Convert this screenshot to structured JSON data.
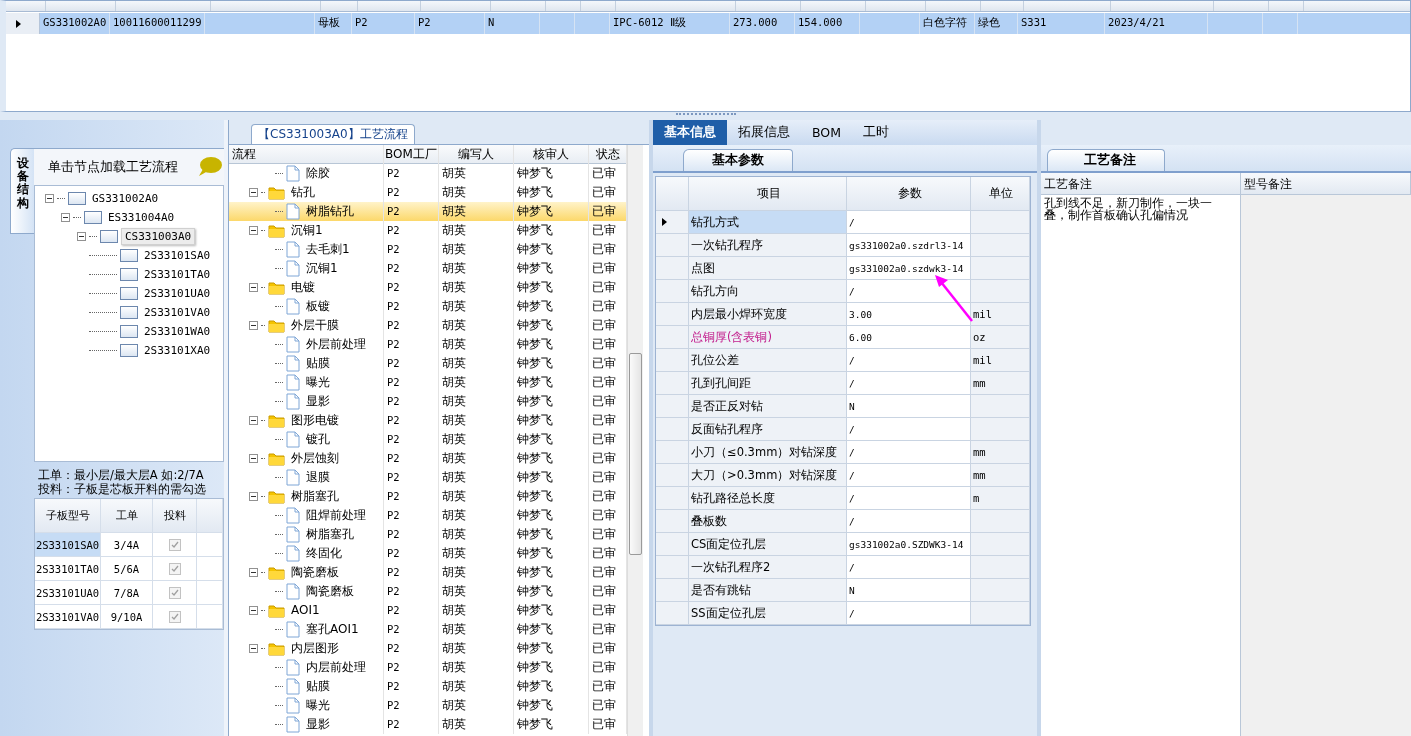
{
  "top_grid": {
    "row": {
      "selected": true,
      "cells": {
        "column_1": "GS331002A0",
        "column_2": "10011600011299",
        "column_4": "母板",
        "column_5": "P2",
        "column_6": "P2",
        "column_7": "N",
        "column_10": "IPC-6012 Ⅱ级",
        "column_11": "273.000",
        "column_12": "154.000",
        "column_14": "白色字符",
        "column_15": "绿色",
        "column_16": "S331",
        "column_17": "2023/4/21"
      }
    }
  },
  "structure_panel": {
    "tab": "设备结构",
    "hint": "单击节点加载工艺流程",
    "tree": [
      {
        "label": "GS331002A0",
        "selected": false,
        "expanded": true,
        "children": [
          {
            "label": "ES331004A0",
            "selected": false,
            "expanded": true,
            "children": [
              {
                "label": "CS331003A0",
                "selected": true,
                "expanded": true,
                "children": [
                  {
                    "label": "2S33101SA0",
                    "selected": false
                  },
                  {
                    "label": "2S33101TA0",
                    "selected": false
                  },
                  {
                    "label": "2S33101UA0",
                    "selected": false
                  },
                  {
                    "label": "2S33101VA0",
                    "selected": false
                  },
                  {
                    "label": "2S33101WA0",
                    "selected": false
                  },
                  {
                    "label": "2S33101XA0",
                    "selected": false
                  }
                ]
              }
            ]
          }
        ]
      }
    ],
    "notes": [
      "工单：最小层/最大层A 如:2/7A",
      "投料：子板是芯板开料的需勾选"
    ],
    "subboard_table": {
      "columns": [
        "子板型号",
        "工单",
        "投料"
      ],
      "rows": [
        {
          "model": "2S33101SA0",
          "work_order": "3/4A",
          "feed": true,
          "selected": true
        },
        {
          "model": "2S33101TA0",
          "work_order": "5/6A",
          "feed": true,
          "selected": false
        },
        {
          "model": "2S33101UA0",
          "work_order": "7/8A",
          "feed": true,
          "selected": false
        },
        {
          "model": "2S33101VA0",
          "work_order": "9/10A",
          "feed": true,
          "selected": false
        }
      ]
    }
  },
  "process_panel": {
    "title": "【CS331003A0】工艺流程",
    "columns": [
      "流程",
      "BOM工厂",
      "编写人",
      "核审人",
      "状态"
    ],
    "nodes": [
      {
        "label": "除胶",
        "factory": "P2",
        "writer": "胡英",
        "reviewer": "钟梦飞",
        "status": "已审",
        "selected": false
      },
      {
        "label": "钻孔",
        "factory": "P2",
        "writer": "胡英",
        "reviewer": "钟梦飞",
        "status": "已审",
        "selected": false,
        "expanded": true,
        "children": [
          {
            "label": "树脂钻孔",
            "factory": "P2",
            "writer": "胡英",
            "reviewer": "钟梦飞",
            "status": "已审",
            "selected": true
          }
        ]
      },
      {
        "label": "沉铜1",
        "factory": "P2",
        "writer": "胡英",
        "reviewer": "钟梦飞",
        "status": "已审",
        "selected": false,
        "expanded": true,
        "children": [
          {
            "label": "去毛刺1",
            "factory": "P2",
            "writer": "胡英",
            "reviewer": "钟梦飞",
            "status": "已审",
            "selected": false
          },
          {
            "label": "沉铜1",
            "factory": "P2",
            "writer": "胡英",
            "reviewer": "钟梦飞",
            "status": "已审",
            "selected": false
          }
        ]
      },
      {
        "label": "电镀",
        "factory": "P2",
        "writer": "胡英",
        "reviewer": "钟梦飞",
        "status": "已审",
        "selected": false,
        "expanded": true,
        "children": [
          {
            "label": "板镀",
            "factory": "P2",
            "writer": "胡英",
            "reviewer": "钟梦飞",
            "status": "已审",
            "selected": false
          }
        ]
      },
      {
        "label": "外层干膜",
        "factory": "P2",
        "writer": "胡英",
        "reviewer": "钟梦飞",
        "status": "已审",
        "selected": false,
        "expanded": true,
        "children": [
          {
            "label": "外层前处理",
            "factory": "P2",
            "writer": "胡英",
            "reviewer": "钟梦飞",
            "status": "已审",
            "selected": false
          },
          {
            "label": "贴膜",
            "factory": "P2",
            "writer": "胡英",
            "reviewer": "钟梦飞",
            "status": "已审",
            "selected": false
          },
          {
            "label": "曝光",
            "factory": "P2",
            "writer": "胡英",
            "reviewer": "钟梦飞",
            "status": "已审",
            "selected": false
          },
          {
            "label": "显影",
            "factory": "P2",
            "writer": "胡英",
            "reviewer": "钟梦飞",
            "status": "已审",
            "selected": false
          }
        ]
      },
      {
        "label": "图形电镀",
        "factory": "P2",
        "writer": "胡英",
        "reviewer": "钟梦飞",
        "status": "已审",
        "selected": false,
        "expanded": true,
        "children": [
          {
            "label": "镀孔",
            "factory": "P2",
            "writer": "胡英",
            "reviewer": "钟梦飞",
            "status": "已审",
            "selected": false
          }
        ]
      },
      {
        "label": "外层蚀刻",
        "factory": "P2",
        "writer": "胡英",
        "reviewer": "钟梦飞",
        "status": "已审",
        "selected": false,
        "expanded": true,
        "children": [
          {
            "label": "退膜",
            "factory": "P2",
            "writer": "胡英",
            "reviewer": "钟梦飞",
            "status": "已审",
            "selected": false
          }
        ]
      },
      {
        "label": "树脂塞孔",
        "factory": "P2",
        "writer": "胡英",
        "reviewer": "钟梦飞",
        "status": "已审",
        "selected": false,
        "expanded": true,
        "children": [
          {
            "label": "阻焊前处理",
            "factory": "P2",
            "writer": "胡英",
            "reviewer": "钟梦飞",
            "status": "已审",
            "selected": false
          },
          {
            "label": "树脂塞孔",
            "factory": "P2",
            "writer": "胡英",
            "reviewer": "钟梦飞",
            "status": "已审",
            "selected": false
          },
          {
            "label": "终固化",
            "factory": "P2",
            "writer": "胡英",
            "reviewer": "钟梦飞",
            "status": "已审",
            "selected": false
          }
        ]
      },
      {
        "label": "陶瓷磨板",
        "factory": "P2",
        "writer": "胡英",
        "reviewer": "钟梦飞",
        "status": "已审",
        "selected": false,
        "expanded": true,
        "children": [
          {
            "label": "陶瓷磨板",
            "factory": "P2",
            "writer": "胡英",
            "reviewer": "钟梦飞",
            "status": "已审",
            "selected": false
          }
        ]
      },
      {
        "label": "AOI1",
        "factory": "P2",
        "writer": "胡英",
        "reviewer": "钟梦飞",
        "status": "已审",
        "selected": false,
        "expanded": true,
        "children": [
          {
            "label": "塞孔AOI1",
            "factory": "P2",
            "writer": "胡英",
            "reviewer": "钟梦飞",
            "status": "已审",
            "selected": false
          }
        ]
      },
      {
        "label": "内层图形",
        "factory": "P2",
        "writer": "胡英",
        "reviewer": "钟梦飞",
        "status": "已审",
        "selected": false,
        "expanded": true,
        "children": [
          {
            "label": "内层前处理",
            "factory": "P2",
            "writer": "胡英",
            "reviewer": "钟梦飞",
            "status": "已审",
            "selected": false
          },
          {
            "label": "贴膜",
            "factory": "P2",
            "writer": "胡英",
            "reviewer": "钟梦飞",
            "status": "已审",
            "selected": false
          },
          {
            "label": "曝光",
            "factory": "P2",
            "writer": "胡英",
            "reviewer": "钟梦飞",
            "status": "已审",
            "selected": false
          },
          {
            "label": "显影",
            "factory": "P2",
            "writer": "胡英",
            "reviewer": "钟梦飞",
            "status": "已审",
            "selected": false
          }
        ]
      }
    ]
  },
  "detail_panel": {
    "tabs": [
      {
        "label": "基本信息",
        "selected": true
      },
      {
        "label": "拓展信息",
        "selected": false
      },
      {
        "label": "BOM",
        "selected": false
      },
      {
        "label": "工时",
        "selected": false
      }
    ],
    "subtab": "基本参数",
    "columns": [
      "项目",
      "参数",
      "单位"
    ],
    "rows": [
      {
        "item": "钻孔方式",
        "value": "/",
        "selected": true,
        "highlight": false
      },
      {
        "item": "一次钻孔程序",
        "value": "gs331002a0.szdrl3-14",
        "selected": false,
        "highlight": false
      },
      {
        "item": "点图",
        "value": "gs331002a0.szdwk3-14",
        "selected": false,
        "highlight": false
      },
      {
        "item": "钻孔方向",
        "value": "/",
        "selected": false,
        "highlight": false
      },
      {
        "item": "内层最小焊环宽度",
        "value": "3.00",
        "unit": "mil",
        "selected": false,
        "highlight": false
      },
      {
        "item": "总铜厚(含表铜)",
        "value": "6.00",
        "unit": "oz",
        "selected": false,
        "highlight": true
      },
      {
        "item": "孔位公差",
        "value": "/",
        "unit": "mil",
        "selected": false,
        "highlight": false
      },
      {
        "item": "孔到孔间距",
        "value": "/",
        "unit": "mm",
        "selected": false,
        "highlight": false
      },
      {
        "item": "是否正反对钻",
        "value": "N",
        "selected": false,
        "highlight": false
      },
      {
        "item": "反面钻孔程序",
        "value": "/",
        "selected": false,
        "highlight": false
      },
      {
        "item": "小刀（≤0.3mm）对钻深度",
        "value": "/",
        "unit": "mm",
        "selected": false,
        "highlight": false
      },
      {
        "item": "大刀（>0.3mm）对钻深度",
        "value": "/",
        "unit": "mm",
        "selected": false,
        "highlight": false
      },
      {
        "item": "钻孔路径总长度",
        "value": "/",
        "unit": "m",
        "selected": false,
        "highlight": false
      },
      {
        "item": "叠板数",
        "value": "/",
        "selected": false,
        "highlight": false
      },
      {
        "item": "CS面定位孔层",
        "value": "gs331002a0.SZDWK3-14",
        "selected": false,
        "highlight": false
      },
      {
        "item": "一次钻孔程序2",
        "value": "/",
        "selected": false,
        "highlight": false
      },
      {
        "item": "是否有跳钻",
        "value": "N",
        "selected": false,
        "highlight": false
      },
      {
        "item": "SS面定位孔层",
        "value": "/",
        "selected": false,
        "highlight": false
      }
    ]
  },
  "notes_panel": {
    "tab": "工艺备注",
    "columns": [
      "工艺备注",
      "型号备注"
    ],
    "process_note": "孔到线不足，新刀制作，一块一叠，制作首板确认孔偏情况"
  }
}
